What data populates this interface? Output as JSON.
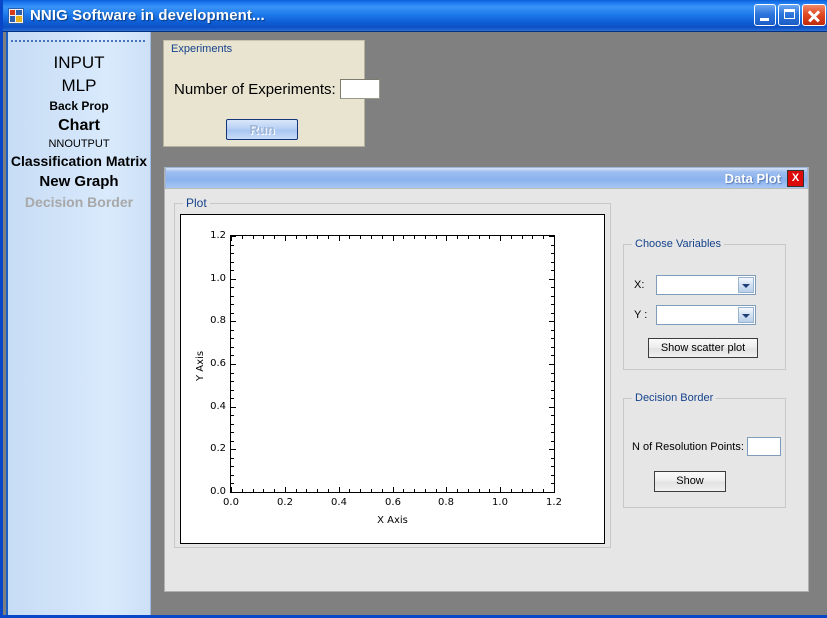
{
  "window": {
    "title": "NNIG Software in development...",
    "icon": "app-icon",
    "controls": {
      "minimize": "minimize-icon",
      "maximize": "maximize-icon",
      "close": "close-icon"
    }
  },
  "sidebar": {
    "items": [
      {
        "label": "INPUT",
        "enabled": true
      },
      {
        "label": "MLP",
        "enabled": true
      },
      {
        "label": "Back Prop",
        "enabled": true
      },
      {
        "label": "Chart",
        "enabled": true
      },
      {
        "label": "NNOUTPUT",
        "enabled": true
      },
      {
        "label": "Classification Matrix",
        "enabled": true
      },
      {
        "label": "New Graph",
        "enabled": true
      },
      {
        "label": "Decision Border",
        "enabled": false
      }
    ]
  },
  "experiments": {
    "legend": "Experiments",
    "number_label": "Number of Experiments:",
    "number_value": "",
    "run_label": "Run"
  },
  "data_plot": {
    "title": "Data Plot",
    "close_label": "X",
    "plot_legend": "Plot",
    "choose_variables": {
      "legend": "Choose Variables",
      "x_label": "X:",
      "x_value": "",
      "y_label": "Y :",
      "y_value": "",
      "scatter_button": "Show scatter plot"
    },
    "decision_border": {
      "legend": "Decision Border",
      "resolution_label": "N of Resolution Points:",
      "resolution_value": "",
      "show_button": "Show"
    }
  },
  "chart_data": {
    "type": "scatter",
    "title": "",
    "xlabel": "X Axis",
    "ylabel": "Y Axis",
    "xlim": [
      0.0,
      1.2
    ],
    "ylim": [
      0.0,
      1.2
    ],
    "xticks": [
      "0.0",
      "0.2",
      "0.4",
      "0.6",
      "0.8",
      "1.0",
      "1.2"
    ],
    "yticks": [
      "0.0",
      "0.2",
      "0.4",
      "0.6",
      "0.8",
      "1.0",
      "1.2"
    ],
    "minor_ticks_per_major": 4,
    "grid": false,
    "legend": null,
    "series": [],
    "x": [],
    "y": []
  }
}
